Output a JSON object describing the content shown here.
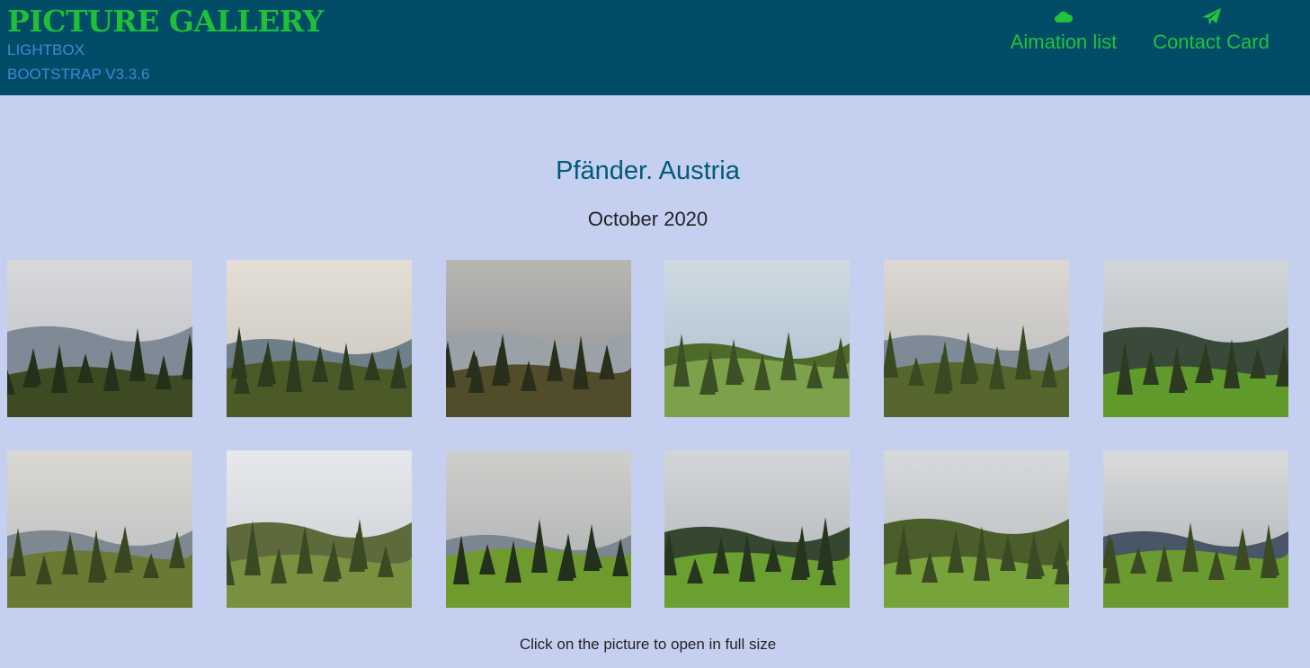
{
  "navbar": {
    "brand": "PICTURE GALLERY",
    "subtitle1": "LIGHTBOX",
    "subtitle2": "BOOTSTRAP V3.3.6",
    "links": [
      {
        "label": "Aimation list",
        "icon": "cloud-icon"
      },
      {
        "label": "Contact Card",
        "icon": "paper-plane-icon"
      }
    ]
  },
  "gallery": {
    "title": "Pfänder. Austria",
    "date": "October 2020",
    "note": "Click on the picture to open in full size",
    "photos": [
      {
        "sky": [
          "#d9d9db",
          "#b8bcc2"
        ],
        "far": "#7f8a96",
        "ground": "#3d4a22",
        "trees": "#23301a"
      },
      {
        "sky": [
          "#e4dfd6",
          "#c6c3bd"
        ],
        "far": "#6f7f8a",
        "ground": "#4b5a27",
        "trees": "#2d3b1e"
      },
      {
        "sky": [
          "#b9b7b4",
          "#8b8c8e"
        ],
        "far": "#9aa2a8",
        "ground": "#514d2b",
        "trees": "#2a2f1c"
      },
      {
        "sky": [
          "#cfdbe3",
          "#a7bccb"
        ],
        "far": "#4e6a2a",
        "ground": "#7da04a",
        "trees": "#3d4f25"
      },
      {
        "sky": [
          "#dcd8d2",
          "#b7b8ba"
        ],
        "far": "#7e8a95",
        "ground": "#56662c",
        "trees": "#394a22"
      },
      {
        "sky": [
          "#d2d6d8",
          "#aeb6ba"
        ],
        "far": "#394a3a",
        "ground": "#5f9a2b",
        "trees": "#2c3a22"
      },
      {
        "sky": [
          "#d9d8d4",
          "#b8babb"
        ],
        "far": "#7d8891",
        "ground": "#6a7a34",
        "trees": "#3a4620"
      },
      {
        "sky": [
          "#e6e8ec",
          "#c9ccd2"
        ],
        "far": "#5f6a3c",
        "ground": "#789040",
        "trees": "#3a4a22"
      },
      {
        "sky": [
          "#cfcfcc",
          "#a9adae"
        ],
        "far": "#7b8690",
        "ground": "#6e9a2e",
        "trees": "#22301c"
      },
      {
        "sky": [
          "#d3d6d8",
          "#aeb3b6"
        ],
        "far": "#35472e",
        "ground": "#6aa032",
        "trees": "#26361e"
      },
      {
        "sky": [
          "#d7d9db",
          "#b4b9bd"
        ],
        "far": "#4c5d2c",
        "ground": "#78a23a",
        "trees": "#3a4a22"
      },
      {
        "sky": [
          "#d9dadb",
          "#a9afb4"
        ],
        "far": "#4a5668",
        "ground": "#6b9a30",
        "trees": "#3b4a22"
      }
    ]
  }
}
